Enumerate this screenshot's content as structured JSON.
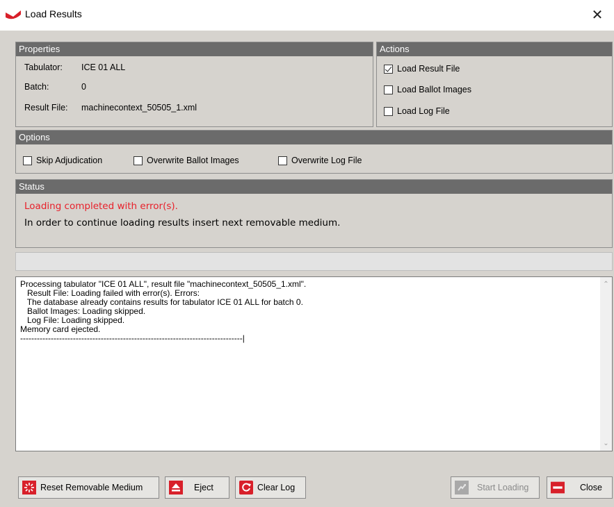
{
  "window": {
    "title": "Load Results",
    "close_glyph": "✕"
  },
  "properties": {
    "header": "Properties",
    "tabulator_label": "Tabulator:",
    "tabulator_value": "ICE 01 ALL",
    "batch_label": "Batch:",
    "batch_value": "0",
    "result_file_label": "Result File:",
    "result_file_value": "machinecontext_50505_1.xml"
  },
  "actions": {
    "header": "Actions",
    "items": [
      {
        "label": "Load Result File",
        "checked": true
      },
      {
        "label": "Load Ballot Images",
        "checked": false
      },
      {
        "label": "Load Log File",
        "checked": false
      }
    ]
  },
  "options": {
    "header": "Options",
    "items": [
      {
        "label": "Skip Adjudication",
        "checked": false
      },
      {
        "label": "Overwrite Ballot Images",
        "checked": false
      },
      {
        "label": "Overwrite Log File",
        "checked": false
      }
    ]
  },
  "status": {
    "header": "Status",
    "error_text": "Loading completed with error(s).",
    "info_text": "In order to continue loading results insert next removable medium."
  },
  "progress": {
    "value": 0
  },
  "log": {
    "text": "Processing tabulator \"ICE 01 ALL\", result file \"machinecontext_50505_1.xml\".\n   Result File: Loading failed with error(s). Errors:\n   The database already contains results for tabulator ICE 01 ALL for batch 0.\n   Ballot Images: Loading skipped.\n   Log File: Loading skipped.\nMemory card ejected.\n--------------------------------------------------------------------------------|"
  },
  "buttons": {
    "reset": "Reset Removable Medium",
    "eject": "Eject",
    "clear_log": "Clear Log",
    "start_loading": "Start Loading",
    "close": "Close"
  },
  "icons": {
    "app": "app-logo-icon",
    "reset": "reset-medium-icon",
    "eject": "eject-icon",
    "clear": "refresh-icon",
    "start": "start-loading-icon",
    "close": "close-icon"
  },
  "colors": {
    "accent": "#d8202a",
    "error_text": "#e8202a",
    "panel_header": "#6b6b6b"
  }
}
